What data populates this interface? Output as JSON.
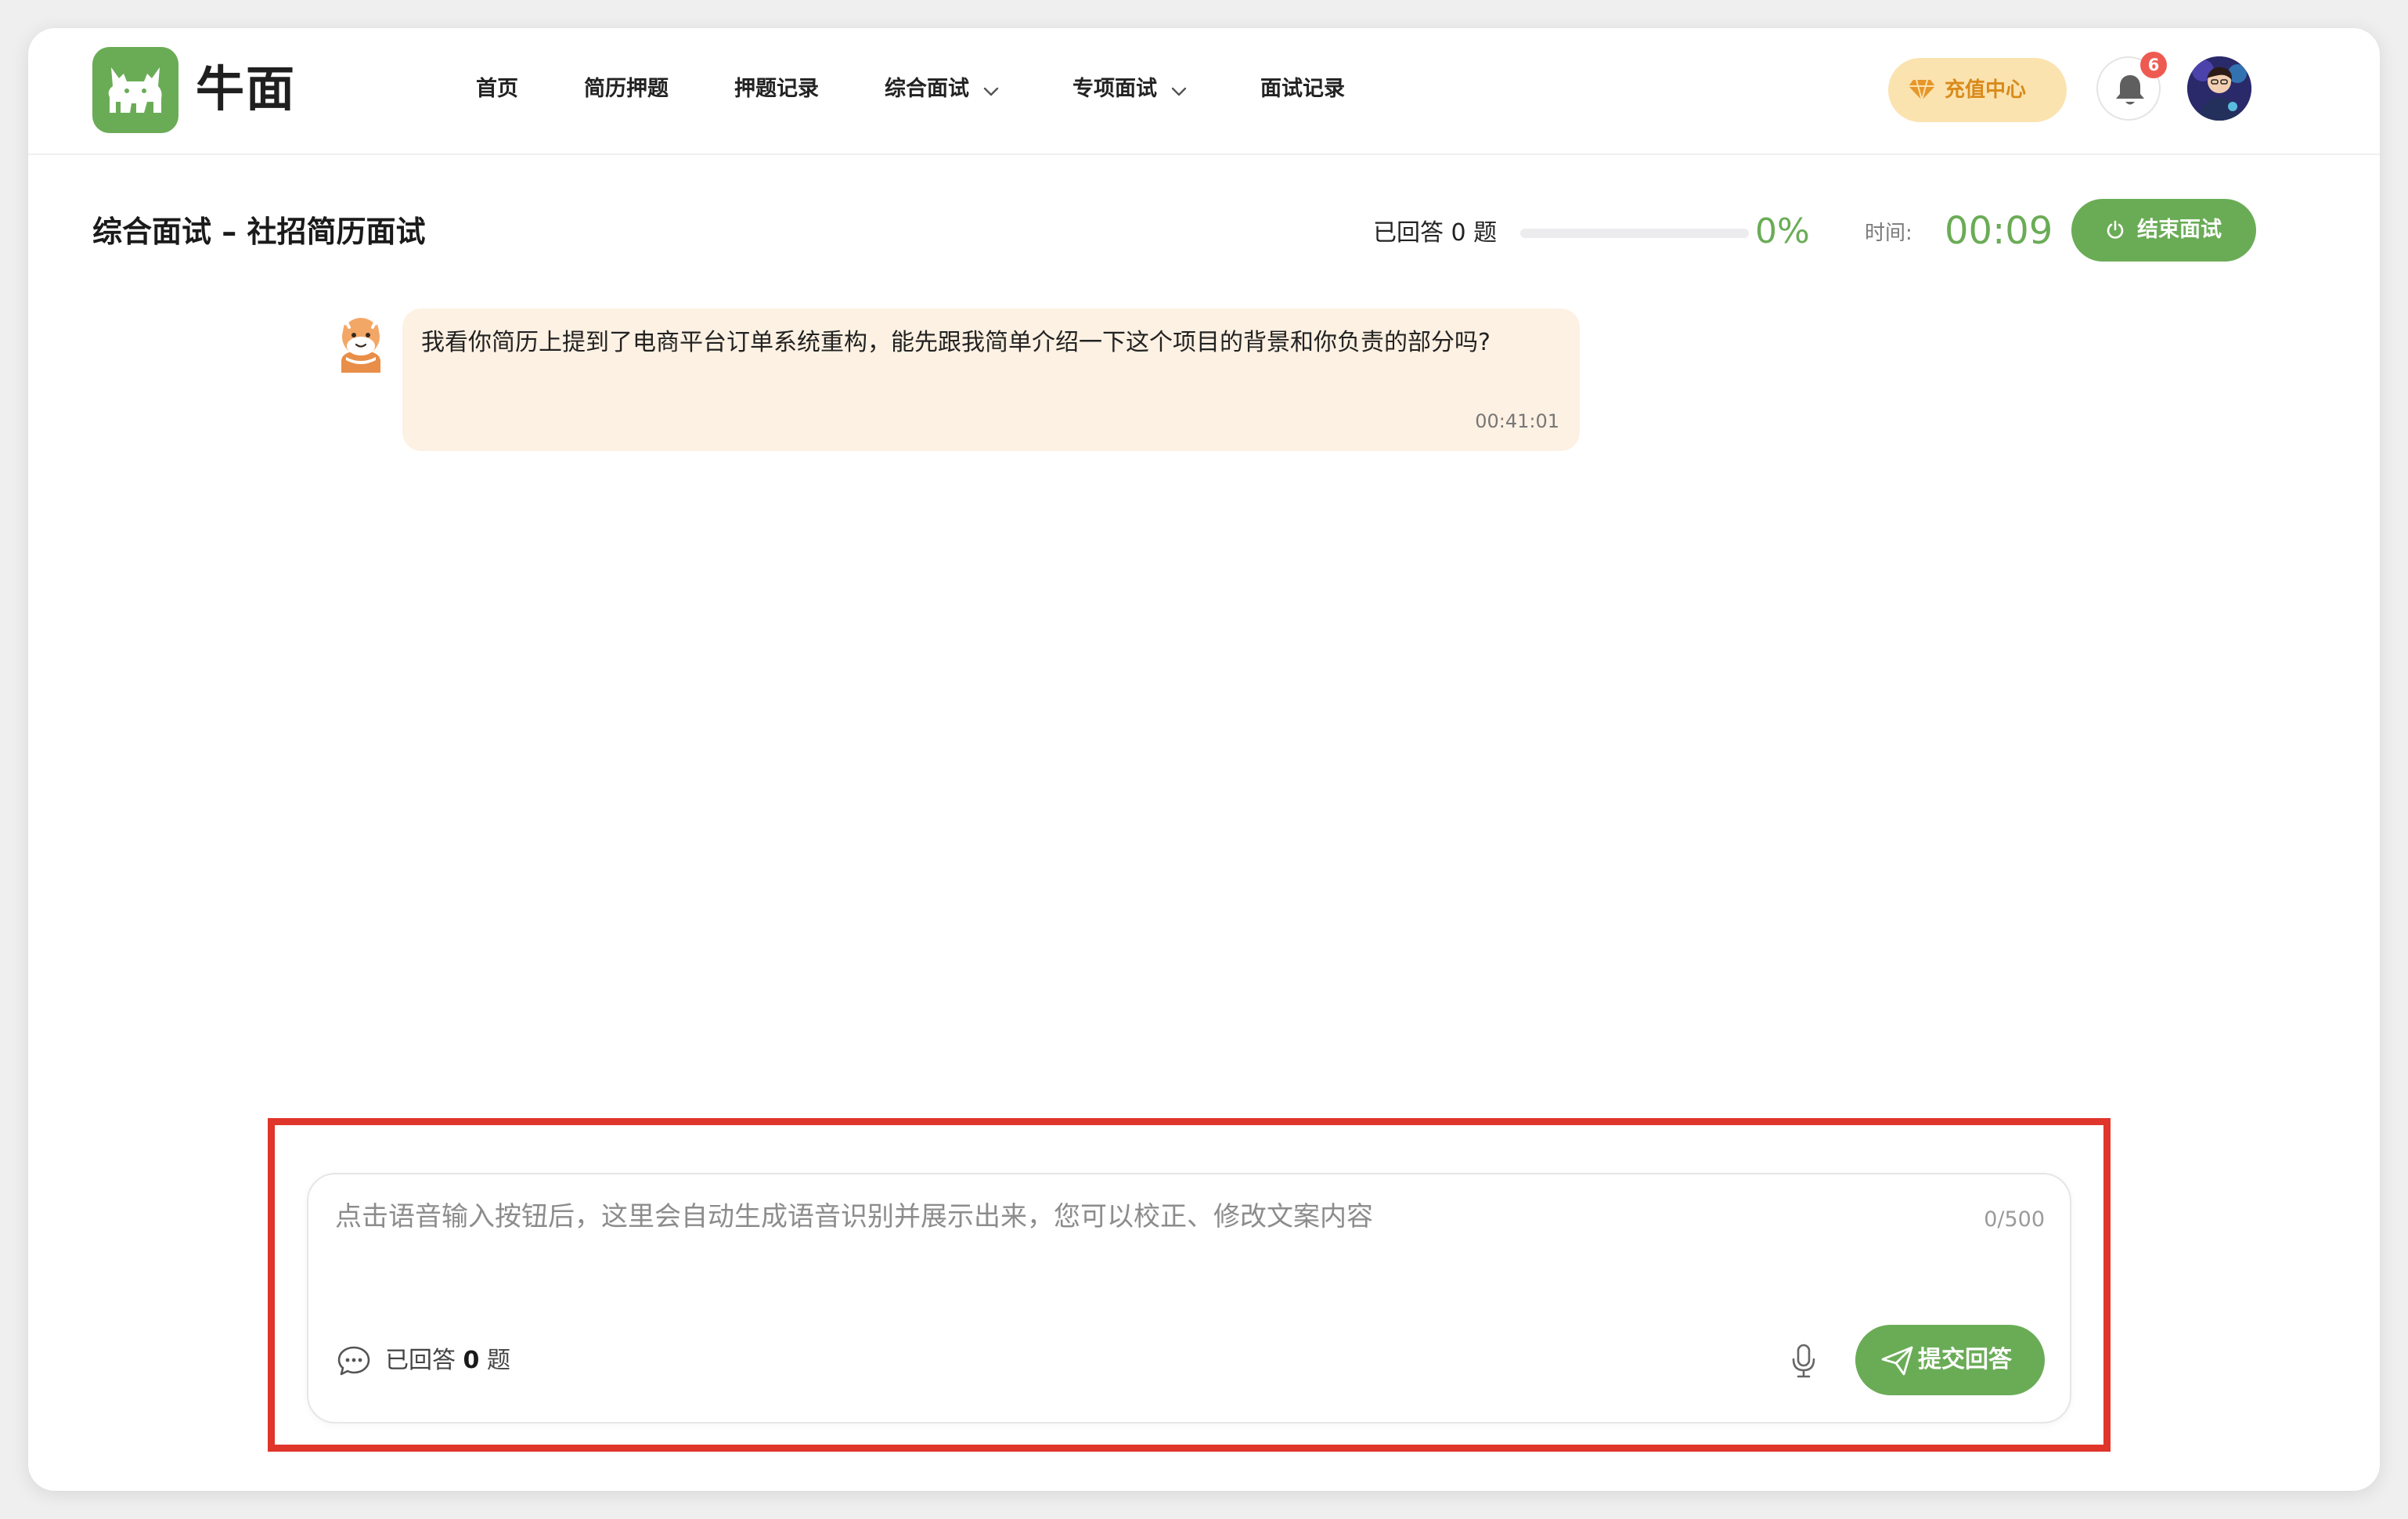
{
  "brand": {
    "name": "牛面"
  },
  "nav": {
    "items": [
      {
        "label": "首页"
      },
      {
        "label": "简历押题"
      },
      {
        "label": "押题记录"
      },
      {
        "label": "综合面试"
      },
      {
        "label": "专项面试"
      },
      {
        "label": "面试记录"
      }
    ]
  },
  "header": {
    "recharge_label": "充值中心",
    "notification_count": "6"
  },
  "session": {
    "title": "综合面试 – 社招简历面试",
    "answered_label": "已回答 0 题",
    "progress_fraction": 0,
    "progress_text": "0%",
    "time_label": "时间:",
    "time_value": "00:09",
    "end_label": "结束面试"
  },
  "chat": {
    "messages": [
      {
        "text": "我看你简历上提到了电商平台订单系统重构，能先跟我简单介绍一下这个项目的背景和你负责的部分吗?",
        "time": "00:41:01"
      }
    ]
  },
  "composer": {
    "value": "",
    "placeholder": "点击语音输入按钮后，这里会自动生成语音识别并展示出来，您可以校正、修改文案内容",
    "counter": "0/500",
    "answered_prefix": "已回答",
    "answered_count": "0",
    "answered_suffix": "题",
    "submit_label": "提交回答"
  },
  "colors": {
    "accent": "#6aac56",
    "recharge_bg": "#fbe3b0",
    "recharge_text": "#d98a1a",
    "bubble_bg": "#fdf1e3",
    "badge": "#ee5a52",
    "highlight_border": "#e0352b"
  },
  "icons": {
    "logo": "bull-logo-icon",
    "recharge": "diamond-icon",
    "bell": "bell-icon",
    "end": "power-icon",
    "chat": "chat-bubble-icon",
    "mic": "microphone-icon",
    "submit": "send-icon",
    "dropdown": "chevron-down-icon"
  }
}
